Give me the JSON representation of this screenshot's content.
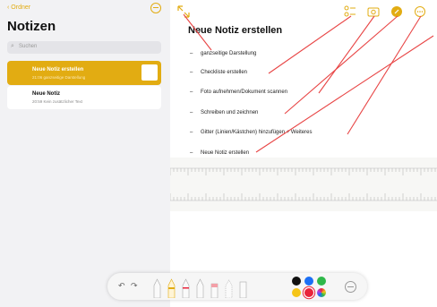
{
  "sidebar": {
    "back_label": "Ordner",
    "title": "Notizen",
    "search_placeholder": "Suchen",
    "notes": [
      {
        "title": "Neue Notiz erstellen",
        "meta": "21:06 ganzseitige Darstellung",
        "selected": true
      },
      {
        "title": "Neue Notiz",
        "meta": "20:59 Kein zusätzlicher Text",
        "selected": false
      }
    ]
  },
  "editor": {
    "title": "Neue Notiz erstellen",
    "bullets": [
      "ganzseitige Darstellung",
      "Checkliste erstellen",
      "Foto aufnehmen/Dokument scannen",
      "Schreiben und zeichnen",
      "Gitter (Linien/Kästchen) hinzufügen + Weiteres",
      "Neue Notiz erstellen"
    ]
  },
  "toolbar": {
    "icons": [
      "expand-icon",
      "checklist-icon",
      "camera-icon",
      "markup-icon",
      "more-icon"
    ]
  },
  "drawing_palette": {
    "tools": [
      "undo-icon",
      "redo-icon",
      "pen-tool",
      "marker-tool",
      "pencil-tool",
      "crayon-tool",
      "eraser-tool",
      "lasso-tool",
      "ruler-tool"
    ],
    "colors": [
      "#111111",
      "#1b6ff5",
      "#2fb84a",
      "#f5c518",
      "#e8243b",
      "multicolor"
    ]
  },
  "colors": {
    "accent": "#e2ac12",
    "annotation": "#e84545",
    "sidebar_bg": "#f2f2f4"
  }
}
